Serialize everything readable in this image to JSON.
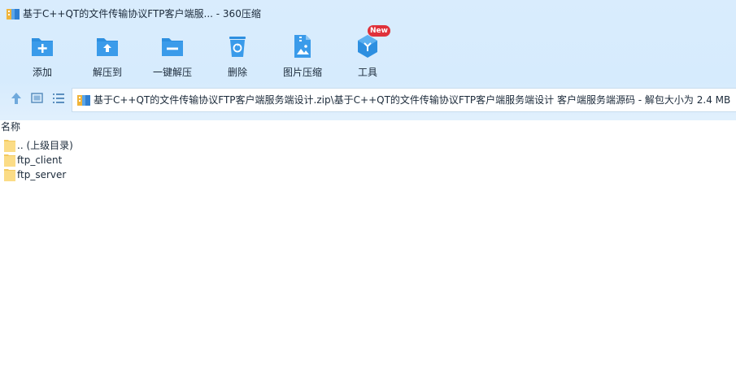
{
  "window": {
    "title": "基于C++QT的文件传输协议FTP客户端服... - 360压缩"
  },
  "toolbar": {
    "items": [
      {
        "label": "添加",
        "icon": "folder-add-icon"
      },
      {
        "label": "解压到",
        "icon": "folder-extract-icon"
      },
      {
        "label": "一键解压",
        "icon": "folder-quick-extract-icon"
      },
      {
        "label": "删除",
        "icon": "recycle-bin-icon"
      },
      {
        "label": "图片压缩",
        "icon": "image-compress-icon"
      },
      {
        "label": "工具",
        "icon": "tools-cube-icon",
        "badge": "New"
      }
    ],
    "accent": "#2d8fe0",
    "badge_color": "#e0313a"
  },
  "navbar": {
    "up_icon": "up-arrow-icon",
    "view_icon": "thumbnail-view-icon",
    "list_icon": "list-view-icon",
    "address": "基于C++QT的文件传输协议FTP客户端服务端设计.zip\\基于C++QT的文件传输协议FTP客户端服务端设计 客户端服务端源码 - 解包大小为 2.4 MB"
  },
  "list": {
    "header": "名称",
    "items": [
      {
        "name": ".. (上级目录)",
        "icon": "folder-icon"
      },
      {
        "name": "ftp_client",
        "icon": "folder-icon"
      },
      {
        "name": "ftp_server",
        "icon": "folder-icon"
      }
    ]
  }
}
